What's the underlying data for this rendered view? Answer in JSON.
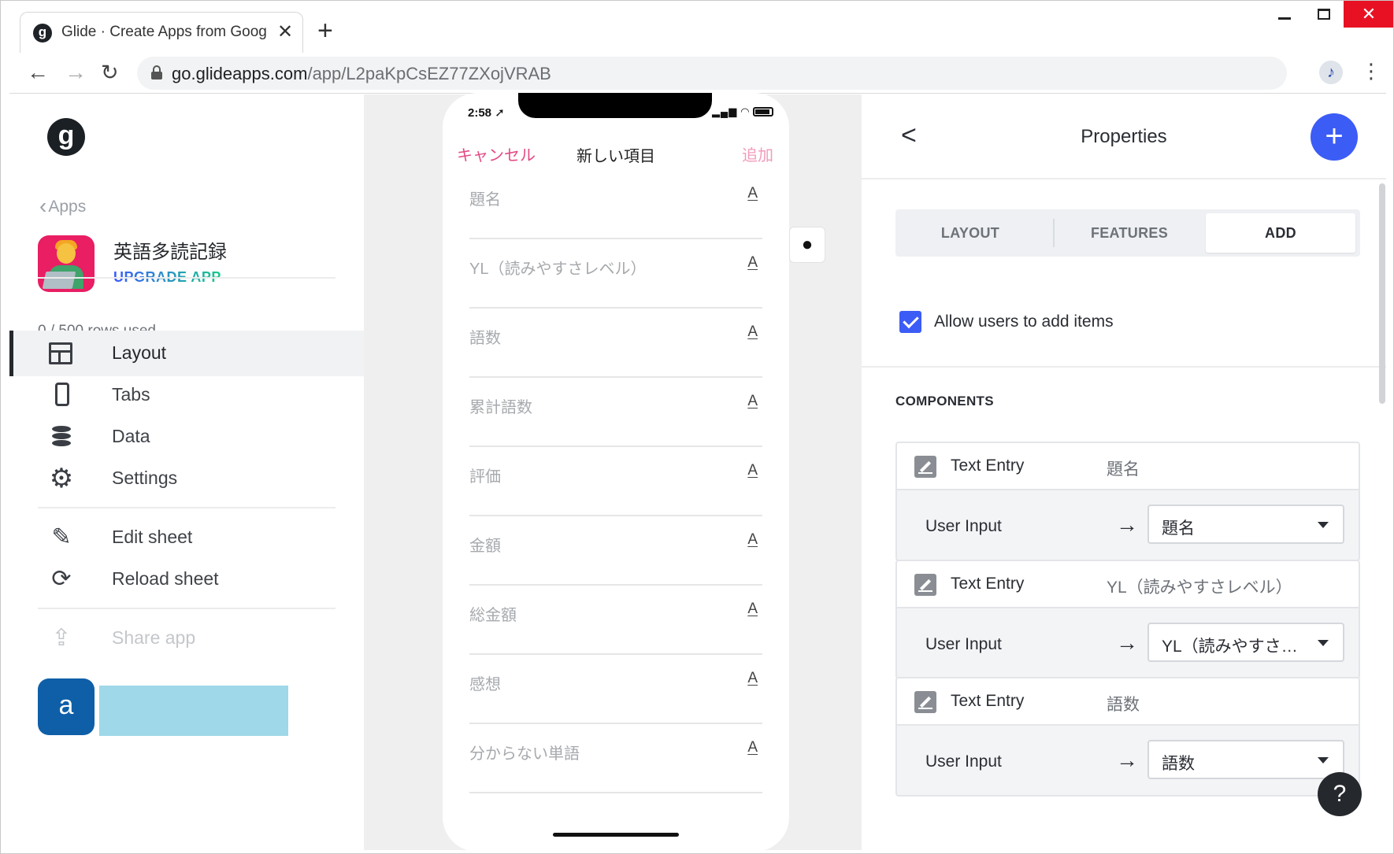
{
  "browser": {
    "tab_title": "Glide · Create Apps from Goog",
    "favicon_letter": "g",
    "tab_close": "✕",
    "new_tab": "+",
    "url_host": "go.glideapps.com",
    "url_path": "/app/L2paKpCsEZ77ZXojVRAB",
    "back_glyph": "←",
    "forward_glyph": "→",
    "reload_glyph": "↻",
    "star_glyph": "☆",
    "extension_glyph": "♪",
    "menu_glyph": "⋮",
    "close_glyph": "✕"
  },
  "sidebar": {
    "logo_letter": "g",
    "apps_link": "Apps",
    "app_name": "英語多読記録",
    "upgrade_label": "UPGRADE APP",
    "rows_used": "0 / 500 rows used",
    "nav": [
      {
        "label": "Layout",
        "icon": "layout-icon",
        "active": true
      },
      {
        "label": "Tabs",
        "icon": "phone-icon"
      },
      {
        "label": "Data",
        "icon": "database-icon"
      },
      {
        "label": "Settings",
        "icon": "gear-icon"
      }
    ],
    "actions": [
      {
        "label": "Edit sheet",
        "icon": "pencil-icon"
      },
      {
        "label": "Reload sheet",
        "icon": "reload-icon"
      }
    ],
    "share_label": "Share app",
    "avatar_letter": "a"
  },
  "phone": {
    "time": "2:58 ➚",
    "cancel": "キャンセル",
    "title": "新しい項目",
    "add": "追加",
    "field_icon_glyph": "A",
    "fields": [
      "題名",
      "YL（読みやすさレベル）",
      "語数",
      "累計語数",
      "評価",
      "金額",
      "総金額",
      "感想",
      "分からない単語"
    ]
  },
  "properties": {
    "title": "Properties",
    "back_glyph": "<",
    "plus_glyph": "+",
    "tabs": [
      "LAYOUT",
      "FEATURES",
      "ADD"
    ],
    "active_tab": "ADD",
    "allow_add_label": "Allow users to add items",
    "allow_add_checked": true,
    "components_title": "COMPONENTS",
    "components": [
      {
        "type": "Text Entry",
        "name": "題名",
        "row_label": "User Input",
        "value": "題名"
      },
      {
        "type": "Text Entry",
        "name": "YL（読みやすさレベル）",
        "row_label": "User Input",
        "value": "YL（読みやすさレベル）"
      },
      {
        "type": "Text Entry",
        "name": "語数",
        "row_label": "User Input",
        "value": "語数"
      }
    ],
    "arrow_glyph": "→"
  },
  "help_label": "?",
  "colors": {
    "accent": "#3c5cf6",
    "pink": "#e34a84",
    "app_icon": "#e91e63"
  }
}
